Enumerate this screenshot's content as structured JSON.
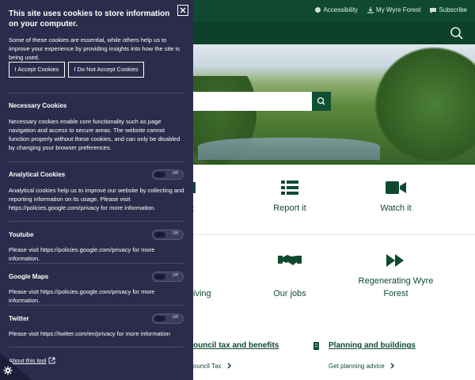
{
  "site": {
    "top_links": [
      "Accessibility",
      "My Wyre Forest",
      "Subscribe"
    ],
    "tiles_row1": [
      {
        "label": "Report it",
        "icon": "list-icon"
      },
      {
        "label": "Watch it",
        "icon": "video-camera-icon"
      }
    ],
    "tiles_row1_partial": "t",
    "tiles_row2": [
      {
        "label": "Our jobs",
        "icon": "handshake-icon"
      },
      {
        "label": "Regenerating Wyre Forest",
        "icon": "fast-forward-icon"
      }
    ],
    "tiles_row2_partial": "iving",
    "sections": [
      {
        "title": "ouncil tax and benefits",
        "link": "ouncil Tax"
      },
      {
        "title": "Planning and buildings",
        "link": "Get planning advice"
      }
    ],
    "colors": {
      "brand": "#0f4a30",
      "panel": "#2b2c4b"
    }
  },
  "cookie_panel": {
    "title": "This site uses cookies to store information on your computer.",
    "intro": "Some of these cookies are essential, while others help us to improve your experience by providing insights into how the site is being used.",
    "accept_label": "I Accept Cookies",
    "decline_label": "I Do Not Accept Cookies",
    "necessary": {
      "heading": "Necessary Cookies",
      "text": "Necessary cookies enable core functionality such as page navigation and access to secure areas. The website cannot function properly without these cookies, and can only be disabled by changing your browser preferences."
    },
    "analytical": {
      "heading": "Analytical Cookies",
      "text": "Analytical cookies help us to improve our website by collecting and reporting information on its usage. Please visit https://policies.google.com/privacy for more information.",
      "state": "Off"
    },
    "youtube": {
      "heading": "Youtube",
      "text": "Please visit https://policies.google.com/privacy for more information.",
      "state": "Off"
    },
    "google_maps": {
      "heading": "Google Maps",
      "text": "Please visit https://policies.google.com/privacy for more information.",
      "state": "Off"
    },
    "twitter": {
      "heading": "Twitter",
      "text": "Please visit https://twitter.com/en/privacy for more information",
      "state": "Off"
    },
    "about_label": "About this tool"
  }
}
